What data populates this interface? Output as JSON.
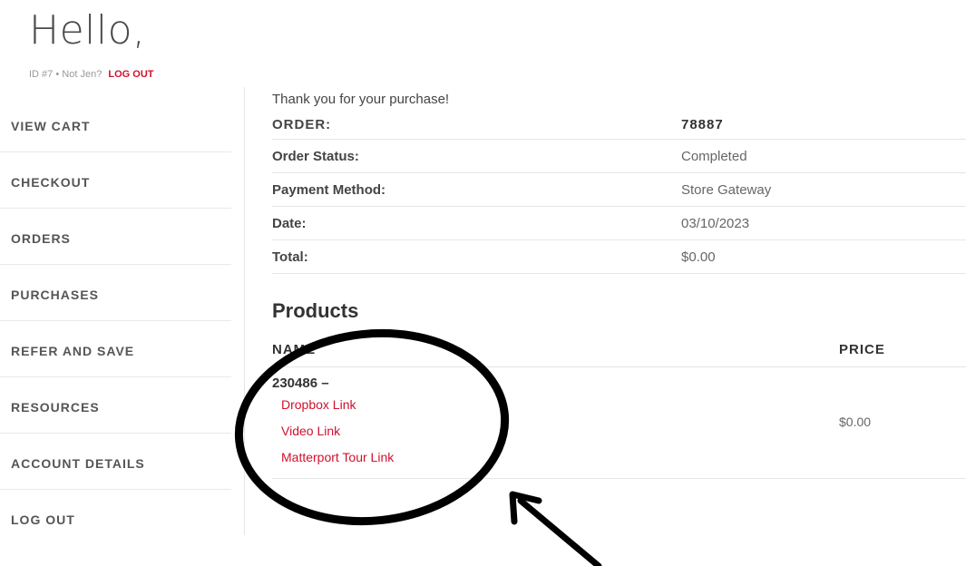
{
  "header": {
    "greeting": "Hello,",
    "id_label": "ID #7",
    "separator": "•",
    "not_user": "Not Jen?",
    "logout_link": "LOG OUT"
  },
  "nav": {
    "items": [
      {
        "label": "VIEW CART"
      },
      {
        "label": "CHECKOUT"
      },
      {
        "label": "ORDERS"
      },
      {
        "label": "PURCHASES"
      },
      {
        "label": "REFER AND SAVE"
      },
      {
        "label": "RESOURCES"
      },
      {
        "label": "ACCOUNT DETAILS"
      },
      {
        "label": "LOG OUT"
      }
    ]
  },
  "order": {
    "thank_you": "Thank you for your purchase!",
    "order_label": "ORDER:",
    "order_number": "78887",
    "rows": [
      {
        "label": "Order Status:",
        "value": "Completed"
      },
      {
        "label": "Payment Method:",
        "value": "Store Gateway"
      },
      {
        "label": "Date:",
        "value": "03/10/2023"
      },
      {
        "label": "Total:",
        "value": "$0.00"
      }
    ]
  },
  "products": {
    "title": "Products",
    "col_name": "NAME",
    "col_price": "PRICE",
    "items": [
      {
        "id": "230486 –",
        "links": [
          "Dropbox Link",
          "Video Link",
          "Matterport Tour Link"
        ],
        "price": "$0.00"
      }
    ]
  },
  "annotation": {
    "stroke_color": "#000000"
  },
  "colors": {
    "accent": "#d0102e",
    "text": "#333333",
    "muted": "#9a9a9a",
    "divider": "#e6e6e6"
  }
}
